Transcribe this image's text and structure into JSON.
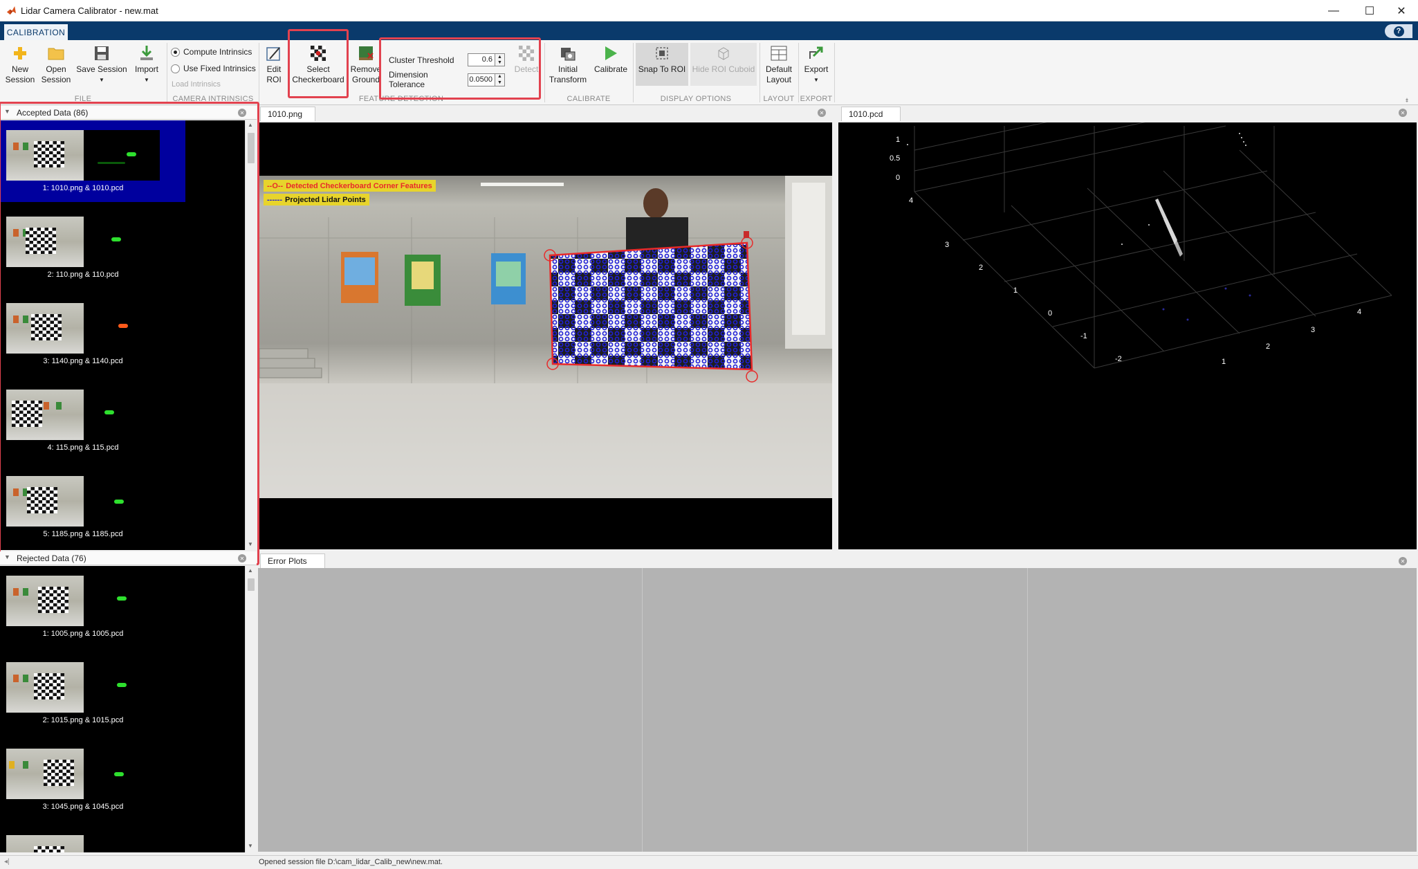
{
  "window": {
    "title": "Lidar Camera Calibrator - new.mat",
    "minimize": "—",
    "maximize": "☐",
    "close": "✕"
  },
  "tabs": {
    "calibration": "CALIBRATION",
    "help": "?"
  },
  "toolstrip": {
    "file": {
      "section": "FILE",
      "new_session": [
        "New",
        "Session"
      ],
      "open_session": [
        "Open",
        "Session"
      ],
      "save_session": "Save Session",
      "import": "Import"
    },
    "intrinsics": {
      "section": "CAMERA INTRINSICS",
      "compute": "Compute Intrinsics",
      "fixed": "Use Fixed Intrinsics",
      "load": "Load Intrinsics",
      "selected": "compute"
    },
    "feature_detection": {
      "section": "FEATURE DETECTION",
      "edit_roi": [
        "Edit",
        "ROI"
      ],
      "select_checkerboard": [
        "Select",
        "Checkerboard"
      ],
      "remove_ground": [
        "Remove",
        "Ground"
      ],
      "cluster_threshold_label": "Cluster Threshold",
      "cluster_threshold_value": "0.6",
      "dimension_tolerance_label": "Dimension Tolerance",
      "dimension_tolerance_value": "0.0500",
      "detect": "Detect"
    },
    "calibrate": {
      "section": "CALIBRATE",
      "initial_transform": [
        "Initial",
        "Transform"
      ],
      "calibrate": "Calibrate"
    },
    "display": {
      "section": "DISPLAY OPTIONS",
      "snap_to_roi": "Snap To ROI",
      "hide_roi_cuboid": "Hide ROI Cuboid"
    },
    "layout": {
      "section": "LAYOUT",
      "default_layout": [
        "Default",
        "Layout"
      ]
    },
    "export": {
      "section": "EXPORT",
      "export": "Export"
    }
  },
  "accepted": {
    "header": "Accepted Data (86)",
    "items": [
      "1: 1010.png & 1010.pcd",
      "2: 110.png & 110.pcd",
      "3: 1140.png & 1140.pcd",
      "4: 115.png & 115.pcd",
      "5: 1185.png & 1185.pcd"
    ],
    "selected_index": 0
  },
  "rejected": {
    "header": "Rejected Data (76)",
    "items": [
      "1: 1005.png & 1005.pcd",
      "2: 1015.png & 1015.pcd",
      "3: 1045.png & 1045.pcd"
    ]
  },
  "image_view": {
    "tab": "1010.png",
    "legend_corner": "Detected Checkerboard Corner Features",
    "legend_corner_symbol": "--O--",
    "legend_lidar": "Projected Lidar Points",
    "legend_lidar_symbol": "------"
  },
  "pcd_view": {
    "tab": "1010.pcd",
    "z_ticks": [
      "1",
      "0.5",
      "0"
    ],
    "y_ticks": [
      "4",
      "3",
      "2",
      "1",
      "0",
      "-1",
      "-2"
    ],
    "x_ticks": [
      "1",
      "2",
      "3",
      "4"
    ]
  },
  "error_plots": {
    "tab": "Error Plots"
  },
  "status": "Opened session file D:\\cam_lidar_Calib_new\\new.mat.",
  "colors": {
    "tab_bar": "#0a3a6b",
    "highlight": "#e2424f",
    "selection": "#00009e",
    "legend": "#e7d42c",
    "lidar_points": "#1f1fd6",
    "corner_markers": "#e82a2a"
  }
}
